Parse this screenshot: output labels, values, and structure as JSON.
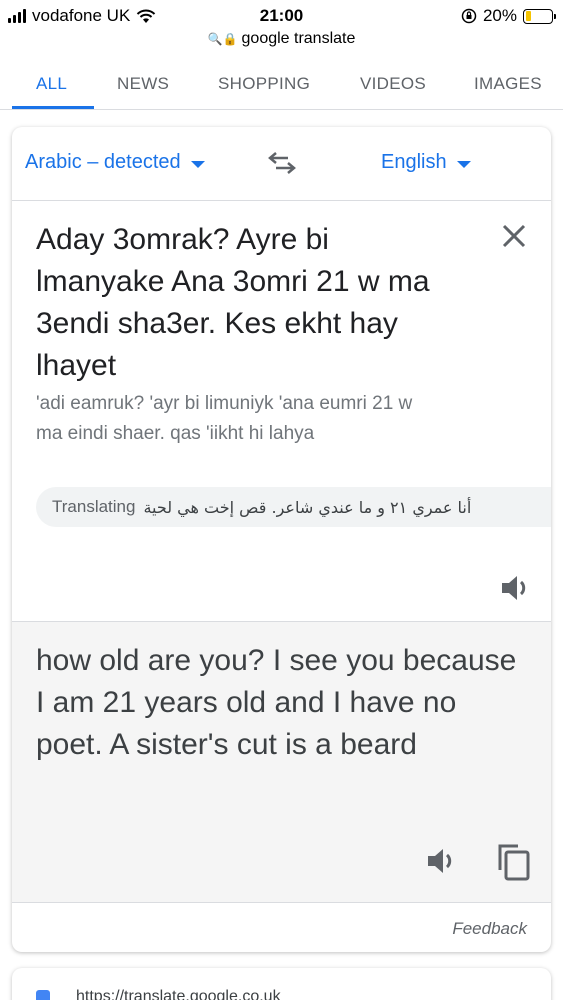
{
  "status": {
    "carrier": "vodafone UK",
    "time": "21:00",
    "battery": "20%",
    "battery_level": 0.2
  },
  "url_bar": {
    "text": "google translate"
  },
  "tabs": [
    {
      "label": "ALL",
      "active": true
    },
    {
      "label": "NEWS",
      "active": false
    },
    {
      "label": "SHOPPING",
      "active": false
    },
    {
      "label": "VIDEOS",
      "active": false
    },
    {
      "label": "IMAGES",
      "active": false
    }
  ],
  "translate": {
    "source_lang": "Arabic – detected",
    "target_lang": "English",
    "source_text": "Aday 3omrak? Ayre bi lmanyake Ana 3omri 21 w ma 3endi sha3er. Kes ekht hay lhayet",
    "transliteration": "'adi eamruk? 'ayr bi limuniyk 'ana eumri 21 w ma eindi shaer. qas 'iikht hi lahya",
    "chip_label": "Translating",
    "chip_arabic": "أنا عمري ٢١ و ما عندي شاعر. قص إخت هي لحية",
    "result_text": "how old are you? I see you because I am 21 years old and I have no poet. A sister's cut is a beard",
    "feedback": "Feedback"
  },
  "next_result": {
    "url": "https://translate.google.co.uk"
  },
  "colors": {
    "accent": "#1a73e8",
    "result_bg": "#f5f5f5",
    "battery": "#f5c400"
  }
}
